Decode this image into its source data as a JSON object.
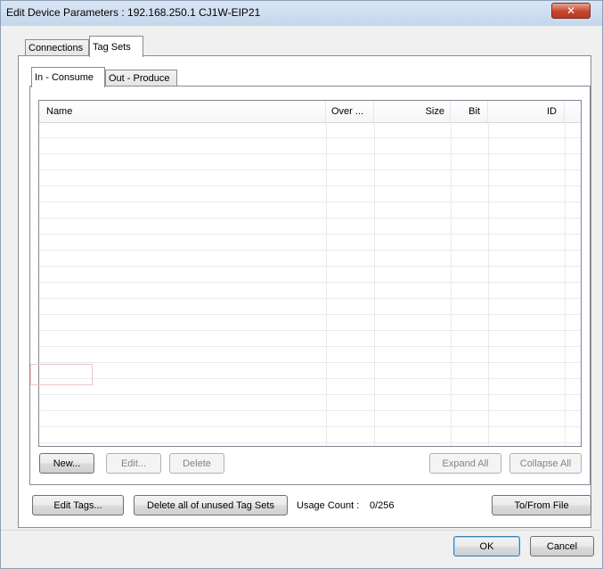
{
  "window": {
    "title": "Edit Device Parameters : 192.168.250.1 CJ1W-EIP21",
    "close_icon": "close-icon"
  },
  "tabs": [
    {
      "label": "Connections",
      "selected": false
    },
    {
      "label": "Tag Sets",
      "selected": true
    }
  ],
  "subtabs": [
    {
      "label": "In - Consume",
      "selected": true
    },
    {
      "label": "Out - Produce",
      "selected": false
    }
  ],
  "grid": {
    "columns": [
      "Name",
      "Over ...",
      "Size",
      "Bit",
      "ID"
    ],
    "rows": []
  },
  "grid_buttons": {
    "new": "New...",
    "edit": "Edit...",
    "delete": "Delete",
    "expand_all": "Expand All",
    "collapse_all": "Collapse All"
  },
  "footer": {
    "edit_tags": "Edit Tags...",
    "delete_unused": "Delete all of unused Tag Sets",
    "usage_label": "Usage Count :",
    "usage_value": "0/256",
    "to_from_file": "To/From File"
  },
  "dialog_buttons": {
    "ok": "OK",
    "cancel": "Cancel"
  }
}
